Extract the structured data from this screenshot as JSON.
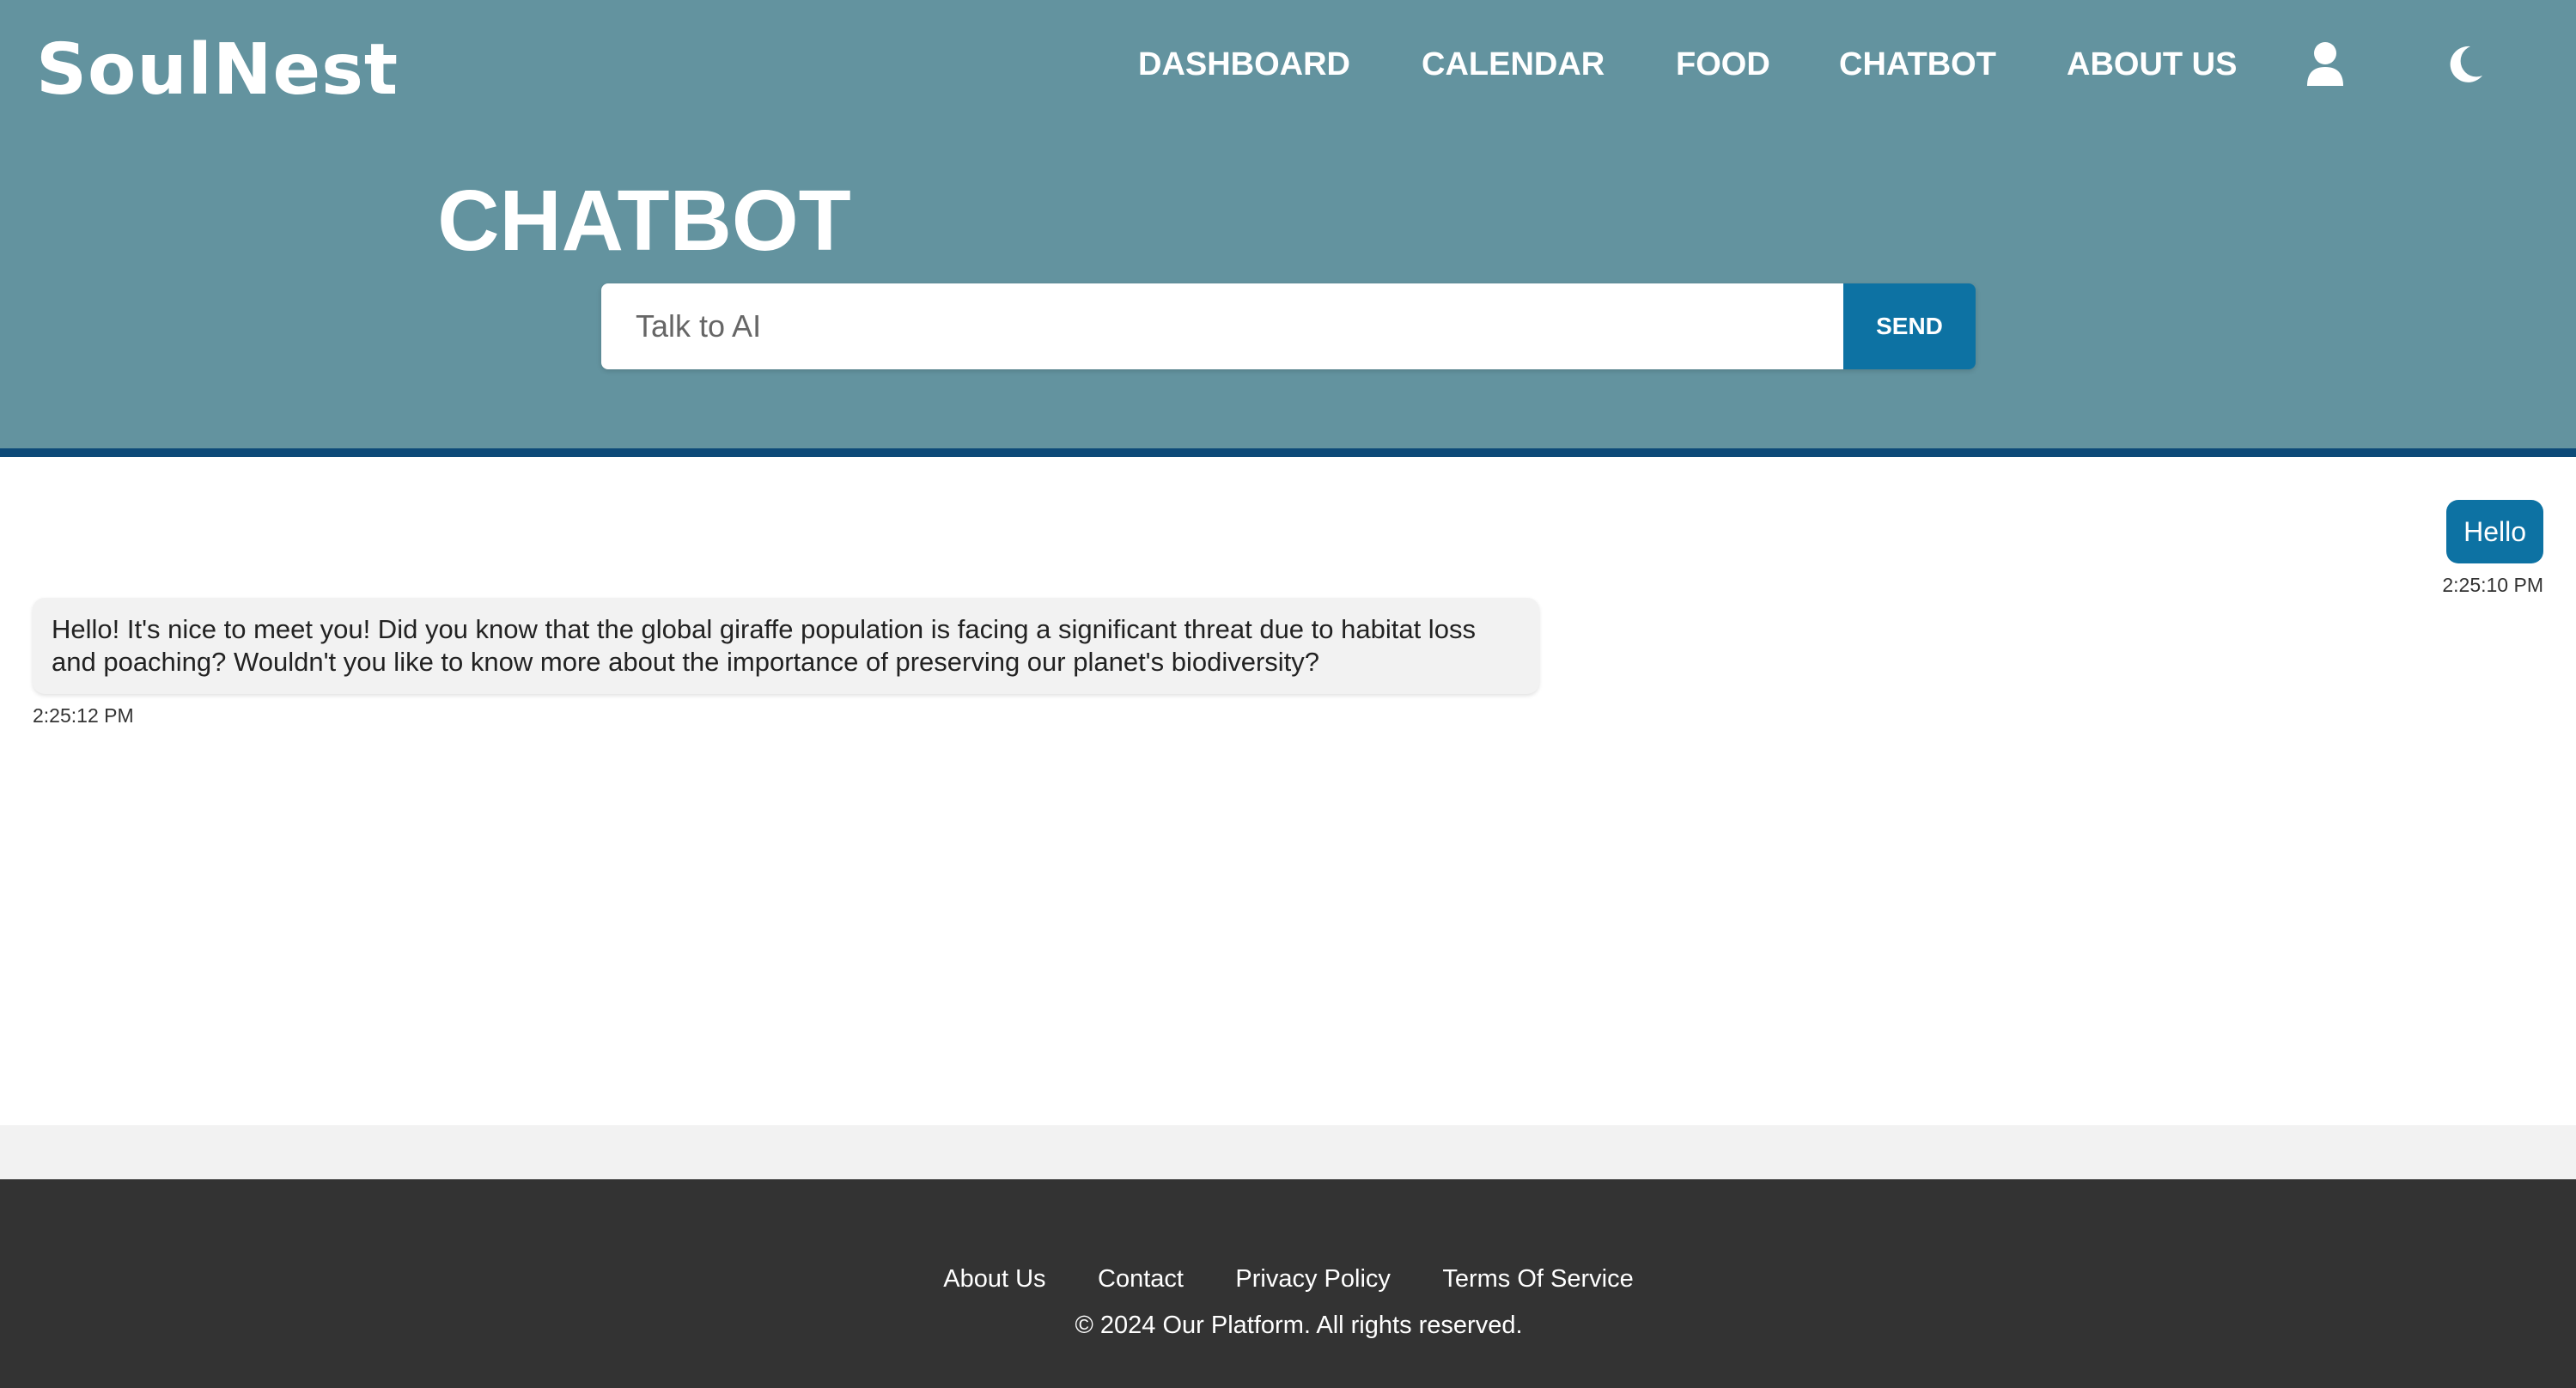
{
  "brand": {
    "name": "SoulNest"
  },
  "nav": {
    "items": [
      {
        "label": "DASHBOARD"
      },
      {
        "label": "CALENDAR"
      },
      {
        "label": "FOOD"
      },
      {
        "label": "CHATBOT"
      },
      {
        "label": "ABOUT US"
      }
    ],
    "profile_icon": "user-icon",
    "theme_icon": "moon-icon"
  },
  "page": {
    "title": "CHATBOT"
  },
  "chat_input": {
    "placeholder": "Talk to AI",
    "value": "",
    "send_label": "SEND"
  },
  "messages": [
    {
      "sender": "user",
      "text": "Hello",
      "time": "2:25:10 PM"
    },
    {
      "sender": "bot",
      "text": "Hello! It's nice to meet you! Did you know that the global giraffe population is facing a significant threat due to habitat loss and poaching? Wouldn't you like to know more about the importance of preserving our planet's biodiversity?",
      "time": "2:25:12 PM"
    }
  ],
  "footer": {
    "links": [
      {
        "label": "About Us"
      },
      {
        "label": "Contact"
      },
      {
        "label": "Privacy Policy"
      },
      {
        "label": "Terms Of Service"
      }
    ],
    "copyright": "© 2024 Our Platform. All rights reserved."
  },
  "colors": {
    "header_bg": "#63939f",
    "header_border": "#0d4a78",
    "accent": "#0d72a3",
    "bot_bubble": "#f2f2f2",
    "footer_bg": "#333333"
  }
}
